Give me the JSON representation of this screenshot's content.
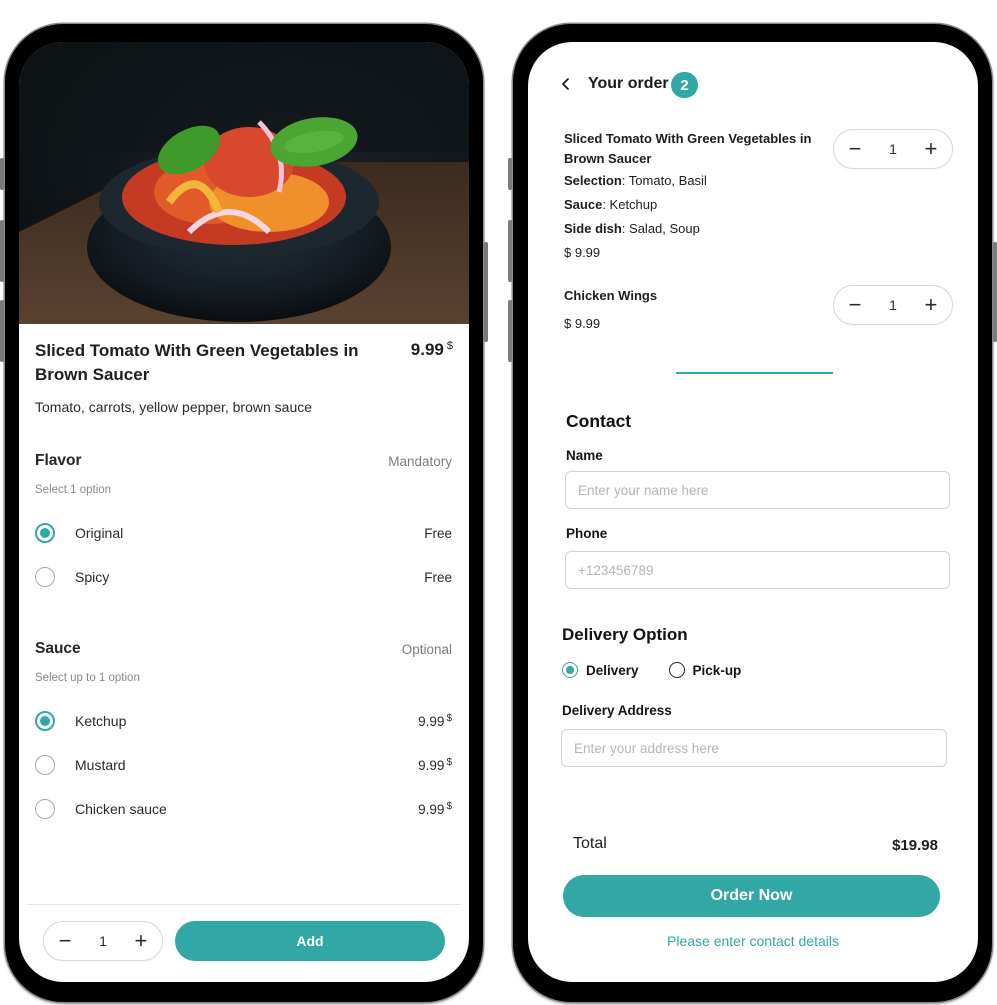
{
  "theme": {
    "accent": "#31a8a6"
  },
  "product_screen": {
    "image_alt": "Bowl of sliced tomato salad with peppers, onion and basil",
    "title": "Sliced Tomato With Green Vegetables in Brown Saucer",
    "price": "9.99",
    "currency": "$",
    "description": "Tomato, carrots, yellow pepper, brown sauce",
    "sections": [
      {
        "title": "Flavor",
        "tag": "Mandatory",
        "hint": "Select 1 option",
        "options": [
          {
            "label": "Original",
            "price": "Free",
            "selected": true
          },
          {
            "label": "Spicy",
            "price": "Free",
            "selected": false
          }
        ]
      },
      {
        "title": "Sauce",
        "tag": "Optional",
        "hint": "Select up to 1 option",
        "options": [
          {
            "label": "Ketchup",
            "price": "9.99",
            "currency": "$",
            "selected": true
          },
          {
            "label": "Mustard",
            "price": "9.99",
            "currency": "$",
            "selected": false
          },
          {
            "label": "Chicken sauce",
            "price": "9.99",
            "currency": "$",
            "selected": false
          }
        ]
      }
    ],
    "quantity": "1",
    "minus": "−",
    "plus": "+",
    "add_label": "Add"
  },
  "order_screen": {
    "title": "Your order",
    "count": "2",
    "items": [
      {
        "name": "Sliced Tomato With Green Vegetables in Brown Saucer",
        "details": [
          {
            "key": "Selection",
            "value": " Tomato, Basil"
          },
          {
            "key": "Sauce",
            "value": " Ketchup"
          },
          {
            "key": "Side dish",
            "value": " Salad, Soup"
          }
        ],
        "price": "$ 9.99",
        "quantity": "1"
      },
      {
        "name": "Chicken Wings",
        "details": [],
        "price": "$ 9.99",
        "quantity": "1"
      }
    ],
    "contact": {
      "title": "Contact",
      "name_label": "Name",
      "name_placeholder": "Enter your name here",
      "name_value": "",
      "phone_label": "Phone",
      "phone_placeholder": "+123456789",
      "phone_value": ""
    },
    "delivery": {
      "title": "Delivery Option",
      "options": [
        {
          "label": "Delivery",
          "selected": true
        },
        {
          "label": "Pick-up",
          "selected": false
        }
      ],
      "address_label": "Delivery Address",
      "address_placeholder": "Enter your address here",
      "address_value": ""
    },
    "total_label": "Total",
    "total_value": "$19.98",
    "order_button": "Order Now",
    "hint": "Please enter contact details"
  }
}
